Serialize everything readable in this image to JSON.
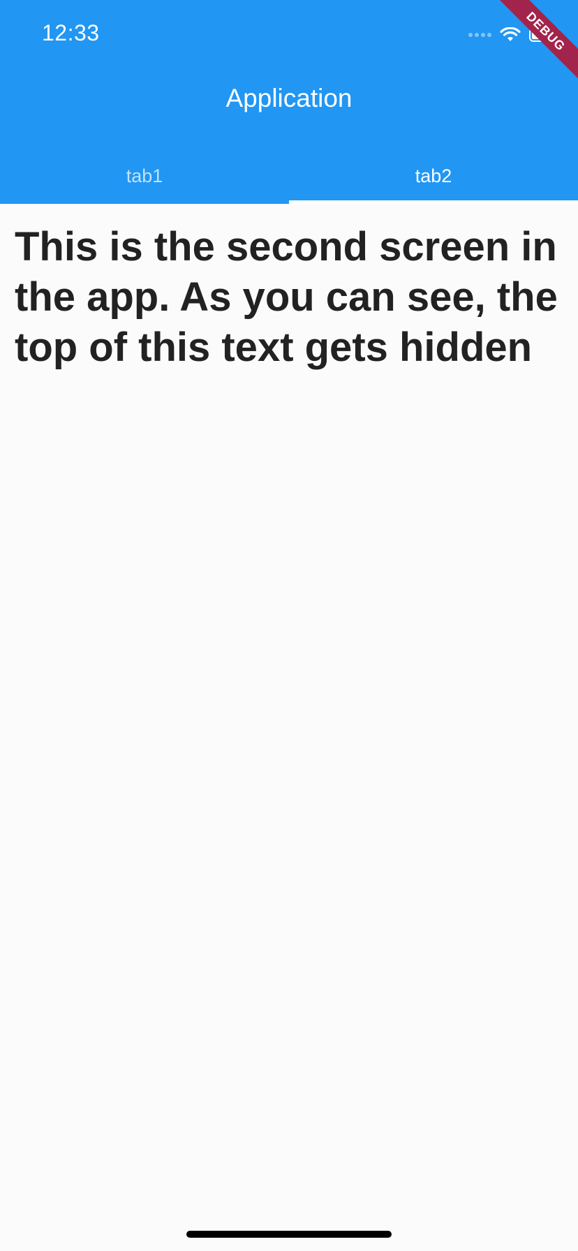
{
  "status_bar": {
    "time": "12:33"
  },
  "app_bar": {
    "title": "Application",
    "background_color": "#2196f3"
  },
  "tabs": [
    {
      "label": "tab1",
      "selected": false
    },
    {
      "label": "tab2",
      "selected": true
    }
  ],
  "debug_banner": {
    "label": "DEBUG",
    "color": "#a3244a"
  },
  "body": {
    "text": "This is the second screen in the app. As you can see, the top of this text gets hidden"
  },
  "icons": {
    "signal": "signal-dots-icon",
    "wifi": "wifi-icon",
    "battery": "battery-icon"
  }
}
